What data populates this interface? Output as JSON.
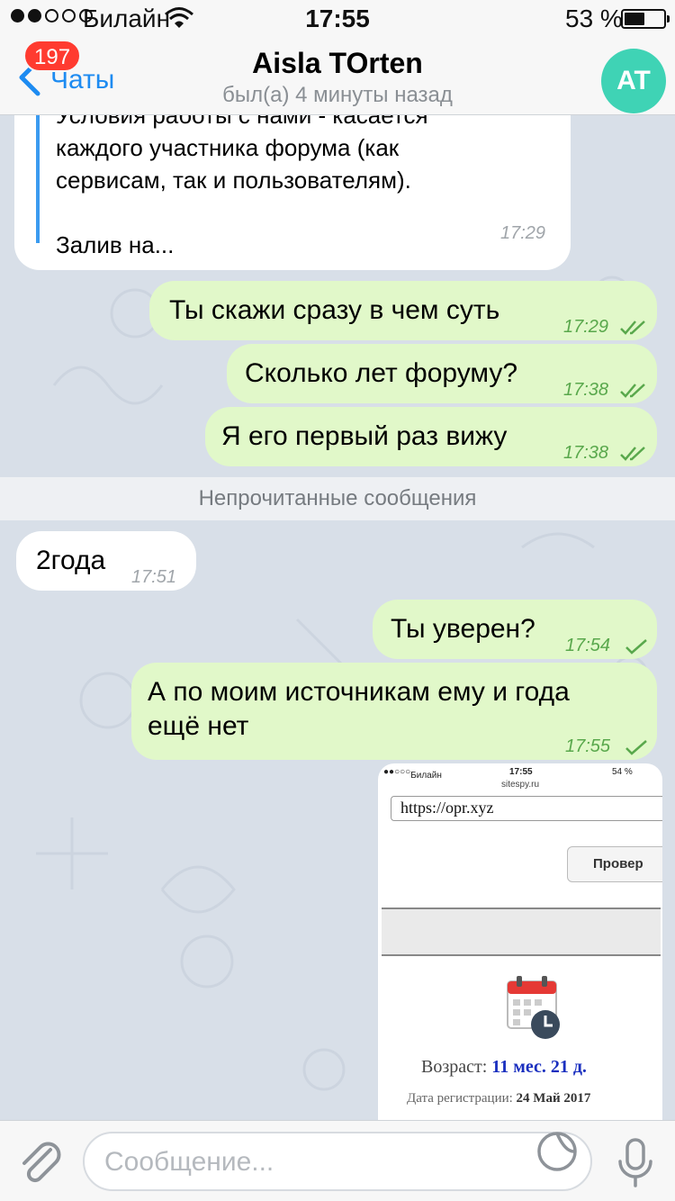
{
  "status": {
    "carrier": "Билайн",
    "time": "17:55",
    "battery": "53 %",
    "battery_level": 0.53
  },
  "header": {
    "back_label": "Чаты",
    "unread_badge": "197",
    "title": "Aisla TOrten",
    "subtitle": "был(а) 4 минуты назад",
    "avatar_initials": "AT"
  },
  "messages": [
    {
      "dir": "in",
      "text_lines": [
        "Условия работы с нами - касается",
        "каждого участника форума (как",
        "сервисам, так и пользователям).",
        "",
        "Залив на..."
      ],
      "time": "17:29"
    },
    {
      "dir": "out",
      "text": "Ты скажи сразу в чем суть",
      "time": "17:29"
    },
    {
      "dir": "out",
      "text": "Сколько лет форуму?",
      "time": "17:38"
    },
    {
      "dir": "out",
      "text": "Я его первый раз вижу",
      "time": "17:38"
    },
    {
      "dir": "in",
      "text": "2года",
      "time": "17:51"
    },
    {
      "dir": "out",
      "text": "Ты уверен?",
      "time": "17:54"
    },
    {
      "dir": "out",
      "text_lines": [
        "А по моим источникам ему и года",
        "ещё нет"
      ],
      "time": "17:55"
    }
  ],
  "unread_divider": "Непрочитанные сообщения",
  "image_message": {
    "status_carrier": "Билайн",
    "status_time": "17:55",
    "status_battery": "54 %",
    "site": "sitespy.ru",
    "url_value": "https://opr.xyz",
    "button": "Провер",
    "age_label": "Возраст:",
    "age_value": "11 мес. 21 д.",
    "reg_label": "Дата регистрации:",
    "reg_value": "24 Май 2017"
  },
  "input": {
    "placeholder": "Сообщение..."
  },
  "colors": {
    "accent": "#1d8bf1",
    "badge": "#ff3b30",
    "avatar": "#3fd3b5",
    "outgoing": "#e1f8c9",
    "check": "#59a84c"
  }
}
